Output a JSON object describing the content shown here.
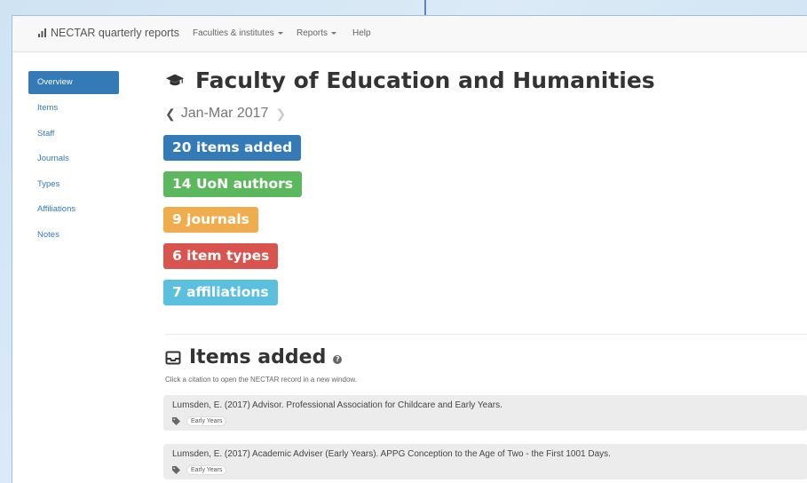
{
  "navbar": {
    "brand": "NECTAR quarterly reports",
    "menu": [
      {
        "label": "Faculties & institutes",
        "dropdown": true
      },
      {
        "label": "Reports",
        "dropdown": true
      },
      {
        "label": "Help",
        "dropdown": false
      }
    ]
  },
  "sidebar": {
    "items": [
      {
        "label": "Overview",
        "active": true
      },
      {
        "label": "Items"
      },
      {
        "label": "Staff"
      },
      {
        "label": "Journals"
      },
      {
        "label": "Types"
      },
      {
        "label": "Affiliations"
      },
      {
        "label": "Notes"
      }
    ]
  },
  "page": {
    "title": "Faculty of Education and Humanities",
    "period": "Jan-Mar 2017"
  },
  "badges": [
    {
      "label": "20 items added",
      "color": "#337ab7"
    },
    {
      "label": "14 UoN authors",
      "color": "#5cb85c"
    },
    {
      "label": "9 journals",
      "color": "#f0ad4e"
    },
    {
      "label": "6 item types",
      "color": "#d9534f"
    },
    {
      "label": "7 affiliations",
      "color": "#5bc0de"
    }
  ],
  "items_section": {
    "title": "Items added",
    "hint": "Click a citation to open the NECTAR record in a new window.",
    "items": [
      {
        "citation": "Lumsden, E. (2017) Advisor. Professional Association for Childcare and Early Years.",
        "tag": "Early Years"
      },
      {
        "citation": "Lumsden, E. (2017) Academic Adviser (Early Years). APPG Conception to the Age of Two - the First 1001 Days.",
        "tag": "Early Years"
      }
    ]
  },
  "icons": {
    "brand": "bar-chart-icon",
    "title": "graduation-cap-icon",
    "section": "inbox-icon",
    "help": "question-circle-icon",
    "tag": "tag-icon"
  }
}
